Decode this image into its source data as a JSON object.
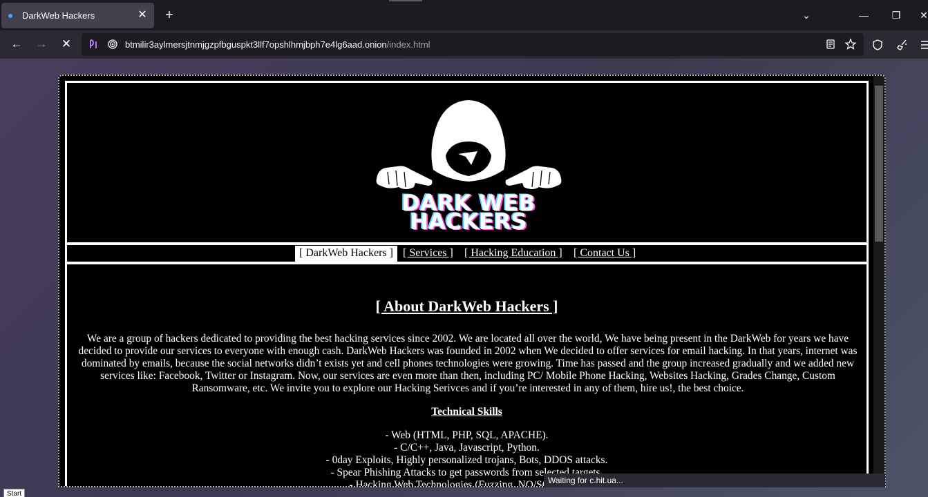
{
  "browser": {
    "tab": {
      "title": "DarkWeb Hackers",
      "close": "✕"
    },
    "new_tab": "+",
    "window_controls": {
      "list_tabs": "⌄",
      "minimize": "—",
      "restore": "❐",
      "close": "✕"
    },
    "nav": {
      "back": "←",
      "forward": "→",
      "stop": "✕"
    },
    "url": {
      "host": "btmilir3aylmersjtnmjgzpfbguspkt3llf7opshlhmjbph7e4lg6aad.onion",
      "path": "/index.html"
    },
    "icons": [
      "reader-mode-icon",
      "bookmark-star-icon",
      "shield-icon",
      "extension-broom-icon",
      "menu-icon"
    ]
  },
  "site": {
    "logo": {
      "line1": "DARK WEB",
      "line2": "HACKERS"
    },
    "menu": [
      "[ DarkWeb Hackers ]",
      "[ Services ]",
      "[ Hacking Education ]",
      "[ Contact Us ]"
    ],
    "about_title": "[ About DarkWeb Hackers ]",
    "about_text": "We are a group of hackers dedicated to providing the best hacking services since 2002. We are located all over the world, We have being present in the DarkWeb for years we have decided to provide our services to everyone with enough cash. DarkWeb Hackers was founded in 2002 when We decided to offer services for email hacking. In that years, internet was dominated by emails, because the social networks didn’t exists yet and cell phones technologies were growing. Time has passed and the group increased gradually and we added new services like: Facebook, Twitter or Instagram. Now, our services are even more than then, including PC/ Mobile Phone Hacking, Websites Hacking, Grades Change, Custom Ransomware, etc. We invite you to explore our Hacking Serivces and if you’re interested in any of them, hire us!, the best choice.",
    "skills_title": "Technical Skills",
    "skills": [
      "- Web (HTML, PHP, SQL, APACHE).",
      "- C/C++, Java, Javascript, Python.",
      "- 0day Exploits, Highly personalized trojans, Bots, DDOS attacks.",
      "- Spear Phishing Attacks to get passwords from selected targets.",
      "- Hacking Web Technologies (Fuzzing, NO/SQLi, XSS"
    ]
  },
  "status": "Waiting for c.hit.ua...",
  "taskbar": {
    "start": "Start"
  },
  "colors": {
    "tabbar": "#1c1b22",
    "navbar": "#2b2a33",
    "logo_pink": "#ff4fd8",
    "logo_cyan": "#5ad1ff"
  }
}
